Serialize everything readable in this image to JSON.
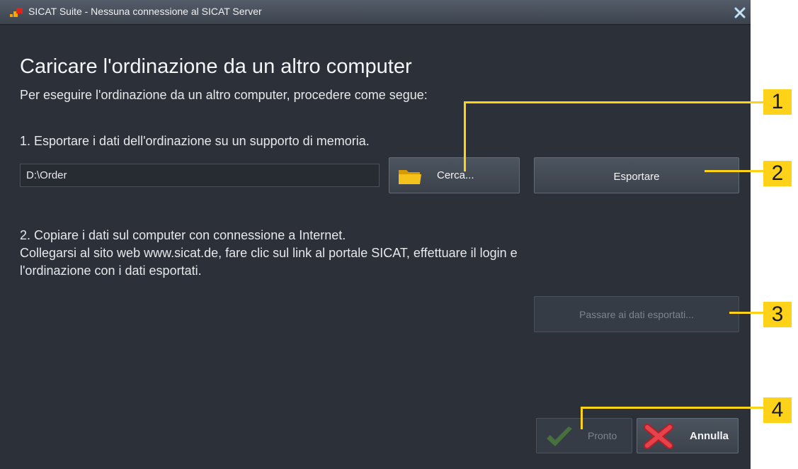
{
  "window": {
    "title": "SICAT Suite - Nessuna connessione al SICAT Server"
  },
  "content": {
    "heading": "Caricare l'ordinazione da un altro computer",
    "intro": "Per eseguire l'ordinazione da un altro computer, procedere come segue:",
    "step1": "1. Esportare i dati dell'ordinazione su un supporto di memoria.",
    "path_value": "D:\\Order",
    "browse_label": "Cerca...",
    "export_label": "Esportare",
    "step2_line1": "2. Copiare i dati sul computer con connessione a Internet.",
    "step2_line2": "Collegarsi al sito web www.sicat.de, fare clic sul link al portale SICAT, effettuare il login e",
    "step2_line3": "l'ordinazione con i dati esportati.",
    "goto_label": "Passare ai dati esportati...",
    "done_label": "Pronto",
    "cancel_label": "Annulla"
  },
  "callouts": [
    "1",
    "2",
    "3",
    "4"
  ],
  "colors": {
    "window_bg": "#2b3039",
    "callout": "#ffd21a",
    "folder": "#f5b800",
    "check": "#5aa83a",
    "cross": "#d9313a"
  },
  "icons": [
    "app-logo-icon",
    "close-icon",
    "folder-icon",
    "check-icon",
    "cross-icon"
  ]
}
